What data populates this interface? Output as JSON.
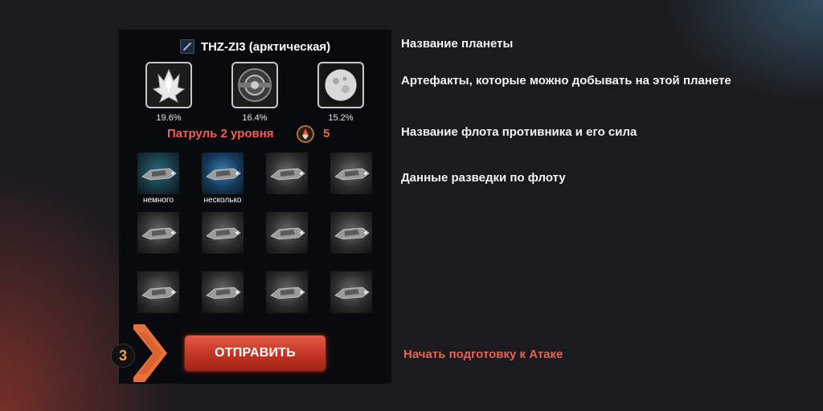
{
  "planet": {
    "name": "THZ-ZI3 (арктическая)",
    "icon": "planet-type-icon"
  },
  "artifacts": [
    {
      "icon": "crystal-icon",
      "percent": "19.6%"
    },
    {
      "icon": "mechanism-icon",
      "percent": "16.4%"
    },
    {
      "icon": "moon-orb-icon",
      "percent": "15.2%"
    }
  ],
  "enemy": {
    "name": "Патруль 2 уровня",
    "power_icon": "fleet-power-icon",
    "power": "5"
  },
  "fleet": {
    "ships": [
      {
        "icon": "ship-icon",
        "label": "немного",
        "color": "green"
      },
      {
        "icon": "ship-icon",
        "label": "несколько",
        "color": "blue"
      },
      {
        "icon": "ship-icon",
        "label": "",
        "color": "grey"
      },
      {
        "icon": "ship-icon",
        "label": "",
        "color": "grey"
      },
      {
        "icon": "ship-icon",
        "label": "",
        "color": "grey"
      },
      {
        "icon": "ship-icon",
        "label": "",
        "color": "grey"
      },
      {
        "icon": "ship-icon",
        "label": "",
        "color": "grey"
      },
      {
        "icon": "ship-icon",
        "label": "",
        "color": "grey"
      },
      {
        "icon": "ship-icon",
        "label": "",
        "color": "grey"
      },
      {
        "icon": "ship-icon",
        "label": "",
        "color": "grey"
      },
      {
        "icon": "ship-icon",
        "label": "",
        "color": "grey"
      },
      {
        "icon": "ship-icon",
        "label": "",
        "color": "grey"
      }
    ]
  },
  "step": {
    "number": "3",
    "icon": "chevron-right-icon"
  },
  "send_button": {
    "label": "ОТПРАВИТЬ"
  },
  "annotations": {
    "planet_name": "Название планеты",
    "artifacts": "Артефакты, которые можно добывать на этой планете",
    "enemy_fleet": "Название флота противника и его сила",
    "scouting": "Данные разведки по флоту",
    "attack": "Начать подготовку к Атаке"
  },
  "colors": {
    "background": "#1b1b1f",
    "panel": "#090a0d",
    "accent_red": "#f0604c",
    "button_red": "#c23424",
    "step_orange": "#f0a040",
    "chevron_orange": "#e8703a"
  }
}
